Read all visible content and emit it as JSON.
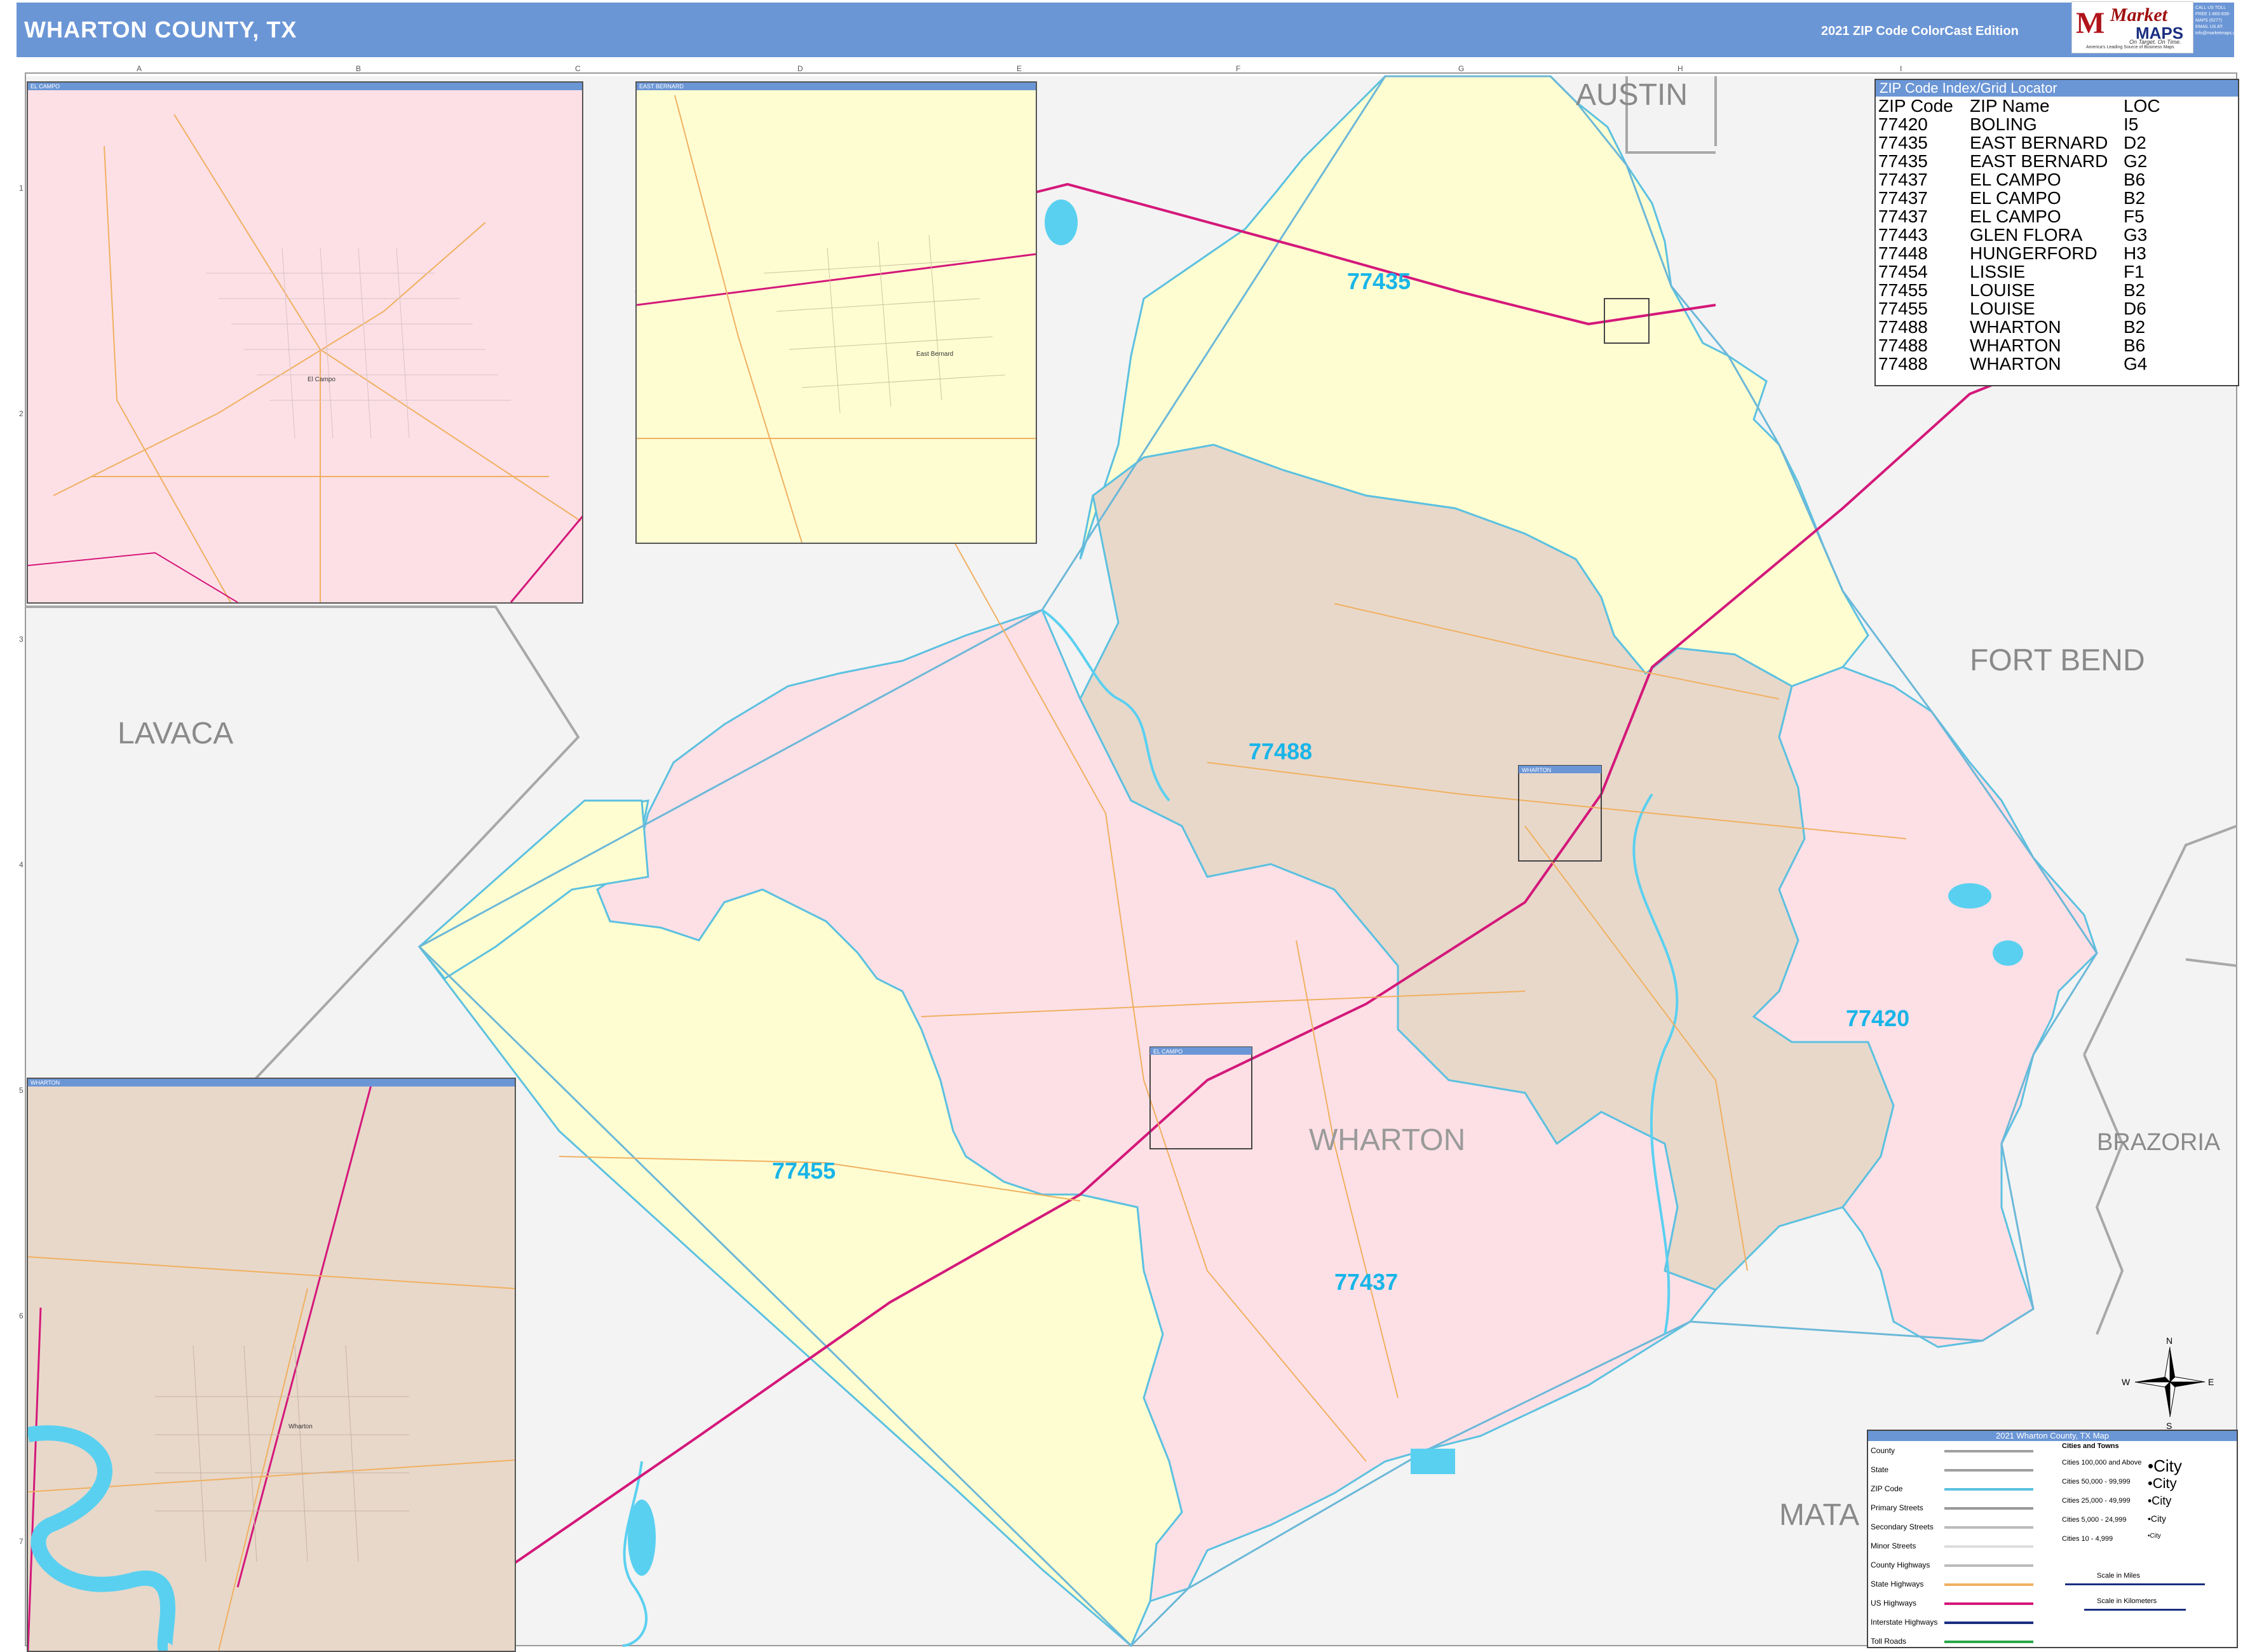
{
  "header": {
    "title": "WHARTON COUNTY, TX",
    "edition": "2021 ZIP Code ColorCast Edition"
  },
  "brand": {
    "line1": "Market",
    "line2": "MAPS",
    "tagline": "On Target. On Time.",
    "subline": "America's Leading Source of Business Maps",
    "contact": "CALL US TOLL FREE 1-800-839-MAPS (6277) EMAIL US AT: info@marketmaps.com"
  },
  "colors": {
    "yellow_zip": "#fefdd2",
    "pink_zip": "#fde0e6",
    "tan_zip": "#e8d8ca",
    "outside": "#f3f3f3",
    "zip_boundary": "#5cc1e0",
    "county_line": "#a0a0a0",
    "water": "#5ad0f0",
    "highway": "#d4187a",
    "road": "#f0b060",
    "header": "#6b96d6"
  },
  "grid": {
    "columns": [
      "A",
      "B",
      "C",
      "D",
      "E",
      "F",
      "G",
      "H",
      "I"
    ],
    "rows": [
      "1",
      "2",
      "3",
      "4",
      "5",
      "6",
      "7"
    ]
  },
  "counties": {
    "austin": "AUSTIN",
    "fort_bend": "FORT BEND",
    "lavaca": "LAVACA",
    "wharton": "WHARTON",
    "brazoria": "BRAZORIA",
    "matagorda": "MATA"
  },
  "zips": {
    "z77435": "77435",
    "z77488": "77488",
    "z77420": "77420",
    "z77455": "77455",
    "z77437": "77437"
  },
  "insets": {
    "el_campo": "EL CAMPO",
    "east_bernard": "EAST BERNARD",
    "wharton": "WHARTON",
    "el_campo_town": "El Campo",
    "east_bernard_town": "East Bernard",
    "wharton_town": "Wharton"
  },
  "map_box_labels": {
    "wharton_box": "WHARTON",
    "el_campo_box": "EL CAMPO"
  },
  "zip_index": {
    "title": "ZIP Code Index/Grid Locator",
    "columns": [
      "ZIP Code",
      "ZIP Name",
      "LOC"
    ],
    "rows": [
      [
        "77420",
        "BOLING",
        "I5"
      ],
      [
        "77435",
        "EAST BERNARD",
        "D2"
      ],
      [
        "77435",
        "EAST BERNARD",
        "G2"
      ],
      [
        "77437",
        "EL CAMPO",
        "B6"
      ],
      [
        "77437",
        "EL CAMPO",
        "B2"
      ],
      [
        "77437",
        "EL CAMPO",
        "F5"
      ],
      [
        "77443",
        "GLEN FLORA",
        "G3"
      ],
      [
        "77448",
        "HUNGERFORD",
        "H3"
      ],
      [
        "77454",
        "LISSIE",
        "F1"
      ],
      [
        "77455",
        "LOUISE",
        "B2"
      ],
      [
        "77455",
        "LOUISE",
        "D6"
      ],
      [
        "77488",
        "WHARTON",
        "B2"
      ],
      [
        "77488",
        "WHARTON",
        "B6"
      ],
      [
        "77488",
        "WHARTON",
        "G4"
      ]
    ]
  },
  "legend": {
    "title": "2021 Wharton County, TX Map",
    "items": [
      "County",
      "State",
      "ZIP Code",
      "Primary Streets",
      "Secondary Streets",
      "Minor Streets",
      "County Highways",
      "State Highways",
      "US Highways",
      "Interstate Highways",
      "Toll Roads"
    ],
    "cities_title": "Cities and Towns",
    "cities": [
      [
        "Cities 100,000 and Above",
        "•City"
      ],
      [
        "Cities 50,000 - 99,999",
        "•City"
      ],
      [
        "Cities 25,000 - 49,999",
        "•City"
      ],
      [
        "Cities 5,000 - 24,999",
        "•City"
      ],
      [
        "Cities 10 - 4,999",
        "•City"
      ]
    ],
    "scale_miles": "Scale in Miles",
    "scale_km": "Scale in Kilometers"
  },
  "compass": {
    "n": "N",
    "s": "S",
    "e": "E",
    "w": "W"
  }
}
